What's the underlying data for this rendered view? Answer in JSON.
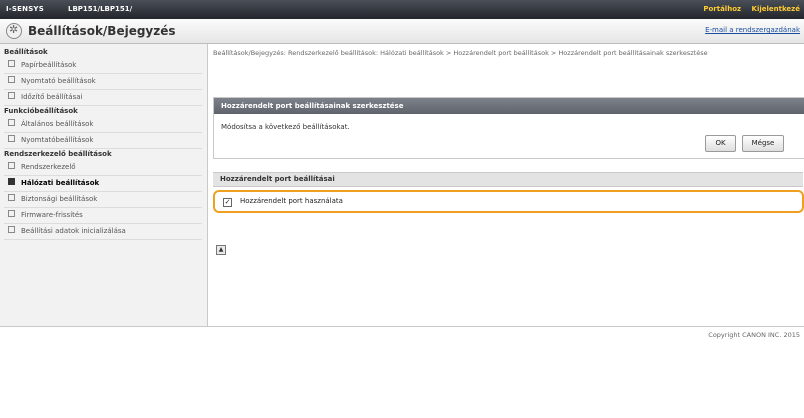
{
  "topbar": {
    "brand": "I-SENSYS",
    "model": "LBP151/LBP151/",
    "links": [
      "Portálhoz",
      "Kijelentkezé"
    ]
  },
  "header": {
    "title": "Beállítások/Bejegyzés",
    "mail_link": "E-mail a rendszergazdának"
  },
  "sidebar": {
    "sections": [
      {
        "title": "Beállítások",
        "items": [
          "Papírbeállítások",
          "Nyomtató beállítások",
          "Időzítő beállításai"
        ]
      },
      {
        "title": "Funkcióbeállítások",
        "items": [
          "Általános beállítások",
          "Nyomtatóbeállítások"
        ]
      },
      {
        "title": "Rendszerkezelő beállítások",
        "items": [
          "Rendszerkezelő",
          "Hálózati beállítások",
          "Biztonsági beállítások",
          "Firmware-frissítés",
          "Beállítási adatok inicializálása"
        ]
      }
    ],
    "active_item": "Hálózati beállítások"
  },
  "main": {
    "breadcrumb": "Beállítások/Bejegyzés: Rendszerkezelő beállítások: Hálózati beállítások > Hozzárendelt port beállítások > Hozzárendelt port beállításainak szerkesztése",
    "edit_panel": {
      "header": "Hozzárendelt port beállításainak szerkesztése",
      "message": "Módosítsa a következő beállításokat.",
      "ok_label": "OK",
      "cancel_label": "Mégse"
    },
    "settings_panel": {
      "header": "Hozzárendelt port beállításai",
      "checkbox_label": "Hozzárendelt port használata",
      "checkbox_checked": true
    },
    "top_icon": "▲"
  },
  "footer": {
    "copyright": "Copyright CANON INC. 2015"
  },
  "colors": {
    "highlight": "#f0a020",
    "link": "#1a4fa0",
    "topbar_link": "#ffcc33"
  }
}
